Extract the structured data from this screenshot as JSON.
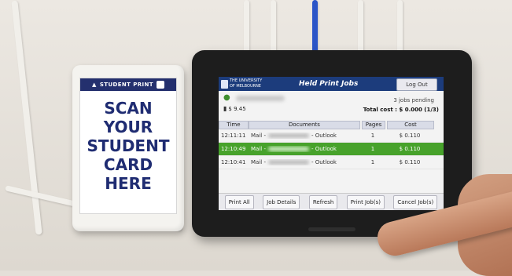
{
  "card_reader": {
    "brand_label": "STUDENT PRINT",
    "instructions": [
      "SCAN",
      "YOUR",
      "STUDENT",
      "CARD",
      "HERE"
    ]
  },
  "app": {
    "university_name": "THE UNIVERSITY OF MELBOURNE",
    "title": "Held Print Jobs",
    "logout_label": "Log Out"
  },
  "account": {
    "balance": "$ 9.45",
    "jobs_pending": "3 jobs pending",
    "total_cost": "Total cost : $ 0.000  (1/3)"
  },
  "table": {
    "columns": [
      "Time",
      "Documents",
      "Pages",
      "Cost"
    ],
    "rows": [
      {
        "time": "12:11:11",
        "doc_prefix": "Mail -",
        "doc_suffix": "- Outlook",
        "pages": "1",
        "cost": "$ 0.110",
        "selected": false
      },
      {
        "time": "12:10:49",
        "doc_prefix": "Mail -",
        "doc_suffix": "- Outlook",
        "pages": "1",
        "cost": "$ 0.110",
        "selected": true
      },
      {
        "time": "12:10:41",
        "doc_prefix": "Mail -",
        "doc_suffix": "- Outlook",
        "pages": "1",
        "cost": "$ 0.110",
        "selected": false
      }
    ]
  },
  "buttons": {
    "print_all": "Print All",
    "job_details": "Job Details",
    "refresh": "Refresh",
    "print_jobs": "Print Job(s)",
    "cancel_jobs": "Cancel Job(s)"
  },
  "colors": {
    "title_bar": "#1c3c7c",
    "selected_row": "#47a22b",
    "card_text": "#1f2c72"
  },
  "icons": {
    "user": "user-icon",
    "wallet": "wallet-icon",
    "card_reader": "card-reader-icon"
  }
}
